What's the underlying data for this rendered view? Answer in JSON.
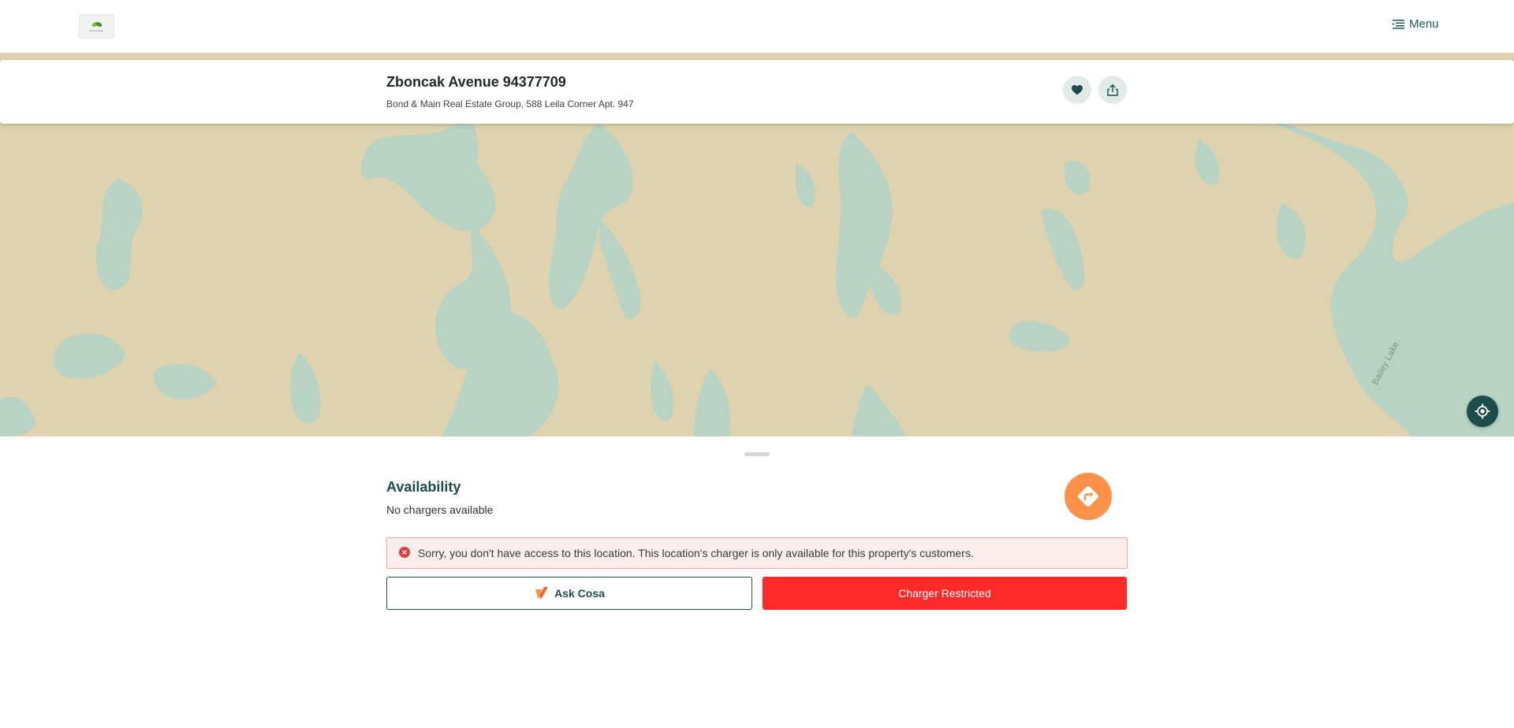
{
  "header": {
    "logo_text": "Bond & Main",
    "menu_label": "Menu"
  },
  "location": {
    "title": "Zboncak Avenue 94377709",
    "subtitle": "Bond & Main Real Estate Group, 588 Leila Corner Apt. 947"
  },
  "map": {
    "place_label": "Bailey Lake",
    "land_color": "#ded3ae",
    "water_color": "#b8d3c4"
  },
  "availability": {
    "title": "Availability",
    "status": "No chargers available"
  },
  "alert": {
    "message": "Sorry, you don't have access to this location. This location's charger is only available for this property's customers."
  },
  "actions": {
    "ask_label": "Ask Cosa",
    "restricted_label": "Charger Restricted"
  },
  "colors": {
    "brand_teal": "#1d4d4a",
    "accent_orange": "#ff9149",
    "danger_red": "#ff2a2a"
  },
  "icons": {
    "menu": "menu-icon",
    "favorite": "heart-icon",
    "share": "share-icon",
    "locate": "crosshair-icon",
    "directions": "directions-icon",
    "error": "error-icon",
    "ask": "cosa-logo-icon"
  }
}
